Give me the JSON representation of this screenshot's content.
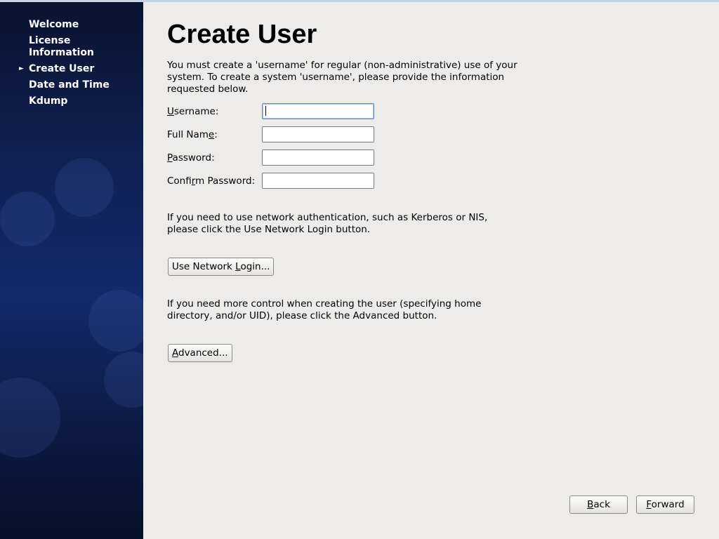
{
  "sidebar": {
    "items": [
      {
        "label": "Welcome"
      },
      {
        "label": "License Information"
      },
      {
        "label": "Create User",
        "current": true
      },
      {
        "label": "Date and Time"
      },
      {
        "label": "Kdump"
      }
    ]
  },
  "main": {
    "title": "Create User",
    "intro": "You must create a 'username' for regular (non-administrative) use of your system.  To create a system 'username', please provide the information requested below.",
    "fields": {
      "username": {
        "label_pre": "",
        "label_key": "U",
        "label_post": "sername:",
        "value": ""
      },
      "fullname": {
        "label_pre": "Full Nam",
        "label_key": "e",
        "label_post": ":",
        "value": ""
      },
      "password": {
        "label_pre": "",
        "label_key": "P",
        "label_post": "assword:",
        "value": ""
      },
      "confirm": {
        "label_pre": "Confi",
        "label_key": "r",
        "label_post": "m Password:",
        "value": ""
      }
    },
    "network_text": "If you need to use network authentication, such as Kerberos or NIS, please click the Use Network Login button.",
    "network_button": {
      "pre": "Use Network ",
      "key": "L",
      "post": "ogin..."
    },
    "advanced_text": "If you need more control when creating the user (specifying home directory, and/or UID), please click the Advanced button.",
    "advanced_button": {
      "pre": "",
      "key": "A",
      "post": "dvanced..."
    }
  },
  "footer": {
    "back": {
      "key": "B",
      "post": "ack"
    },
    "forward": {
      "key": "F",
      "post": "orward"
    }
  },
  "colors": {
    "sidebar_top": "#0a1430",
    "sidebar_mid": "#132a6a",
    "content_bg": "#edeceb",
    "focus_border": "#6d8fbd"
  }
}
